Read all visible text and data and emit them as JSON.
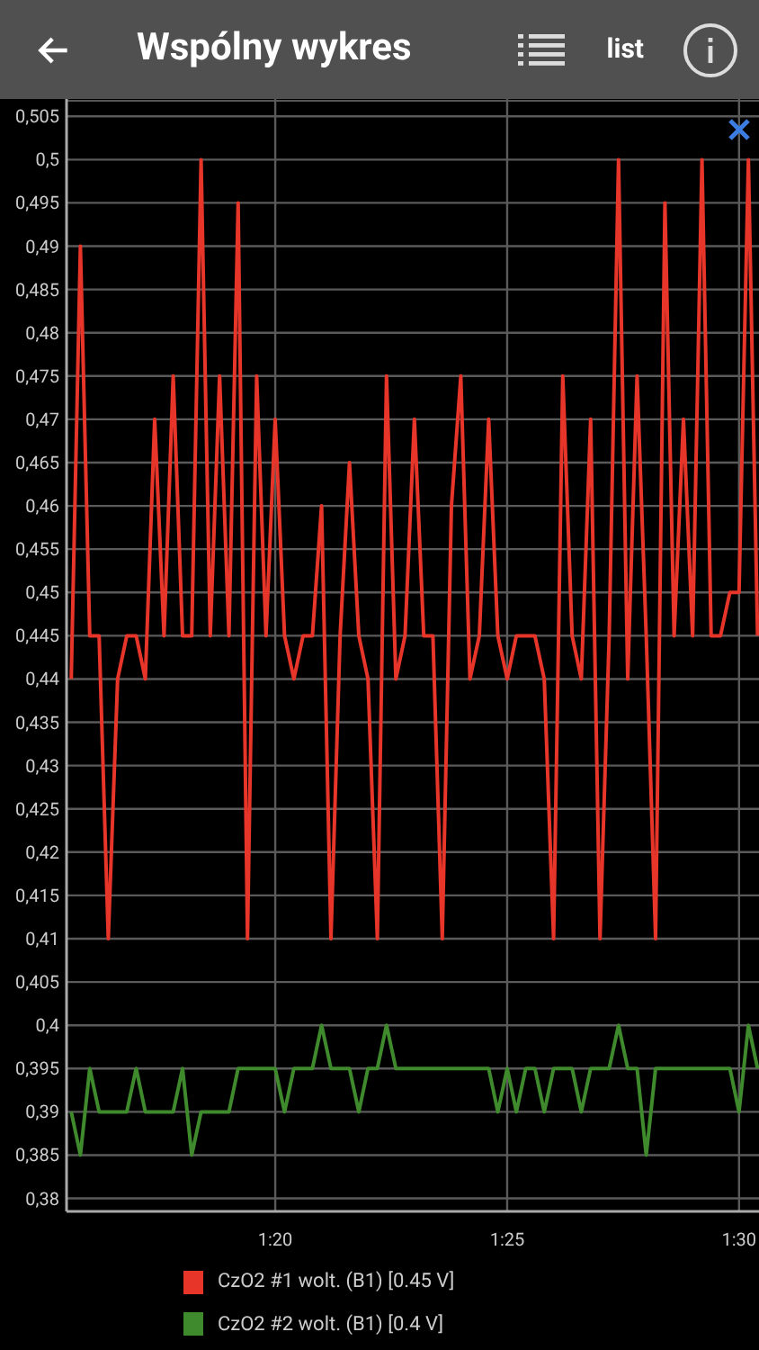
{
  "header": {
    "title": "Wspólny wykres",
    "list_label": "list"
  },
  "chart_data": {
    "type": "line",
    "grid": true,
    "x": [
      75.6,
      75.8,
      76,
      76.2,
      76.4,
      76.6,
      76.8,
      77,
      77.2,
      77.4,
      77.6,
      77.8,
      78,
      78.2,
      78.4,
      78.6,
      78.8,
      79,
      79.2,
      79.4,
      79.6,
      79.8,
      80,
      80.2,
      80.4,
      80.6,
      80.8,
      81,
      81.2,
      81.4,
      81.6,
      81.8,
      82,
      82.2,
      82.4,
      82.6,
      82.8,
      83,
      83.2,
      83.4,
      83.6,
      83.8,
      84,
      84.2,
      84.4,
      84.6,
      84.8,
      85,
      85.2,
      85.4,
      85.6,
      85.8,
      86,
      86.2,
      86.4,
      86.6,
      86.8,
      87,
      87.2,
      87.4,
      87.6,
      87.8,
      88,
      88.2,
      88.4,
      88.6,
      88.8,
      89,
      89.2,
      89.4,
      89.6,
      89.8,
      90,
      90.2,
      90.4
    ],
    "series": [
      {
        "name": "CzO2 #1 wolt. (B1) [0.45 V]",
        "color": "#e8352a",
        "values": [
          0.44,
          0.49,
          0.445,
          0.445,
          0.41,
          0.44,
          0.445,
          0.445,
          0.44,
          0.47,
          0.445,
          0.475,
          0.445,
          0.445,
          0.5,
          0.445,
          0.475,
          0.445,
          0.495,
          0.41,
          0.475,
          0.445,
          0.47,
          0.445,
          0.44,
          0.445,
          0.445,
          0.46,
          0.41,
          0.445,
          0.465,
          0.445,
          0.44,
          0.41,
          0.475,
          0.44,
          0.445,
          0.47,
          0.445,
          0.445,
          0.41,
          0.46,
          0.475,
          0.44,
          0.445,
          0.47,
          0.445,
          0.44,
          0.445,
          0.445,
          0.445,
          0.44,
          0.41,
          0.475,
          0.445,
          0.44,
          0.47,
          0.41,
          0.445,
          0.5,
          0.44,
          0.475,
          0.445,
          0.41,
          0.495,
          0.445,
          0.47,
          0.445,
          0.5,
          0.445,
          0.445,
          0.45,
          0.45,
          0.5,
          0.445
        ]
      },
      {
        "name": "CzO2 #2 wolt. (B1) [0.4 V]",
        "color": "#3f8a2c",
        "values": [
          0.39,
          0.385,
          0.395,
          0.39,
          0.39,
          0.39,
          0.39,
          0.395,
          0.39,
          0.39,
          0.39,
          0.39,
          0.395,
          0.385,
          0.39,
          0.39,
          0.39,
          0.39,
          0.395,
          0.395,
          0.395,
          0.395,
          0.395,
          0.39,
          0.395,
          0.395,
          0.395,
          0.4,
          0.395,
          0.395,
          0.395,
          0.39,
          0.395,
          0.395,
          0.4,
          0.395,
          0.395,
          0.395,
          0.395,
          0.395,
          0.395,
          0.395,
          0.395,
          0.395,
          0.395,
          0.395,
          0.39,
          0.395,
          0.39,
          0.395,
          0.395,
          0.39,
          0.395,
          0.395,
          0.395,
          0.39,
          0.395,
          0.395,
          0.395,
          0.4,
          0.395,
          0.395,
          0.385,
          0.395,
          0.395,
          0.395,
          0.395,
          0.395,
          0.395,
          0.395,
          0.395,
          0.395,
          0.39,
          0.4,
          0.395
        ]
      }
    ],
    "xlim": [
      75.5,
      90.43
    ],
    "ylim": [
      0.3785,
      0.507
    ],
    "xticks": [
      {
        "value": 80,
        "label": "1:20"
      },
      {
        "value": 85,
        "label": "1:25"
      },
      {
        "value": 90,
        "label": "1:30"
      }
    ],
    "yticks": [
      {
        "value": 0.38,
        "label": "0,38"
      },
      {
        "value": 0.385,
        "label": "0,385"
      },
      {
        "value": 0.39,
        "label": "0,39"
      },
      {
        "value": 0.395,
        "label": "0,395"
      },
      {
        "value": 0.4,
        "label": "0,4"
      },
      {
        "value": 0.405,
        "label": "0,405"
      },
      {
        "value": 0.41,
        "label": "0,41"
      },
      {
        "value": 0.415,
        "label": "0,415"
      },
      {
        "value": 0.42,
        "label": "0,42"
      },
      {
        "value": 0.425,
        "label": "0,425"
      },
      {
        "value": 0.43,
        "label": "0,43"
      },
      {
        "value": 0.435,
        "label": "0,435"
      },
      {
        "value": 0.44,
        "label": "0,44"
      },
      {
        "value": 0.445,
        "label": "0,445"
      },
      {
        "value": 0.45,
        "label": "0,45"
      },
      {
        "value": 0.455,
        "label": "0,455"
      },
      {
        "value": 0.46,
        "label": "0,46"
      },
      {
        "value": 0.465,
        "label": "0,465"
      },
      {
        "value": 0.47,
        "label": "0,47"
      },
      {
        "value": 0.475,
        "label": "0,475"
      },
      {
        "value": 0.48,
        "label": "0,48"
      },
      {
        "value": 0.485,
        "label": "0,485"
      },
      {
        "value": 0.49,
        "label": "0,49"
      },
      {
        "value": 0.495,
        "label": "0,495"
      },
      {
        "value": 0.5,
        "label": "0,5"
      },
      {
        "value": 0.505,
        "label": "0,505"
      }
    ]
  }
}
